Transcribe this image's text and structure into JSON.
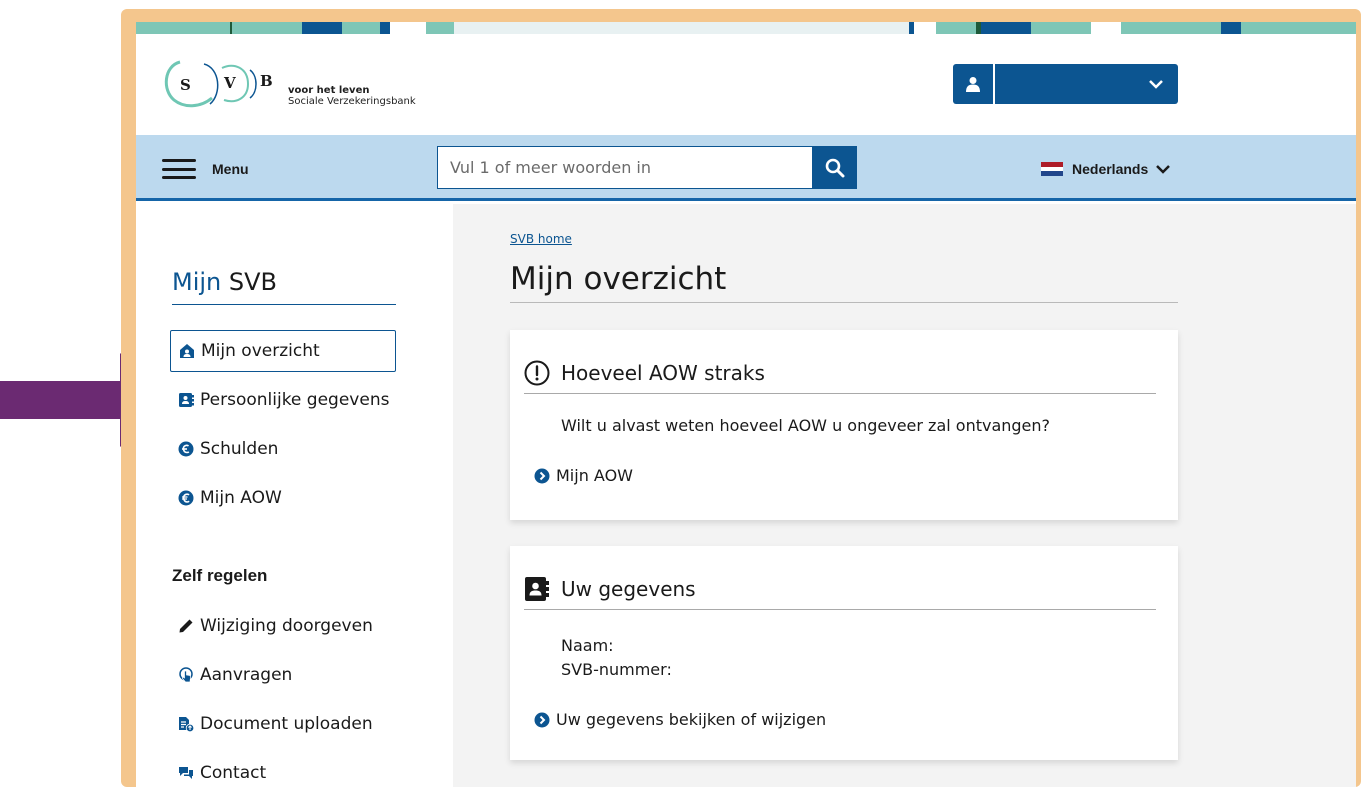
{
  "colors": {
    "frame": "#f4c68d",
    "primary": "#0c5591",
    "nav_bg": "#bcd9ee",
    "main_bg": "#f3f3f3",
    "arrow": "#6b2a72",
    "logo_swoosh": "#6fc7b4"
  },
  "logo": {
    "letters": [
      "S",
      "V",
      "B"
    ],
    "tagline": "voor het leven",
    "org_name": "Sociale Verzekeringsbank"
  },
  "account": {
    "icon": "user-icon",
    "chevron": "chevron-down-icon"
  },
  "nav": {
    "menu_label": "Menu",
    "search_placeholder": "Vul 1 of meer woorden in",
    "search_icon": "search-icon",
    "language": "Nederlands",
    "language_flag": "flag-nl-icon"
  },
  "sidebar": {
    "title_prefix": "Mijn",
    "title_suffix": "SVB",
    "items": [
      {
        "label": "Mijn overzicht",
        "icon": "home-icon",
        "active": true
      },
      {
        "label": "Persoonlijke gegevens",
        "icon": "address-book-icon"
      },
      {
        "label": "Schulden",
        "icon": "euro-minus-icon"
      },
      {
        "label": "Mijn AOW",
        "icon": "euro-icon"
      }
    ],
    "section_title": "Zelf regelen",
    "section_items": [
      {
        "label": "Wijziging doorgeven",
        "icon": "pencil-icon"
      },
      {
        "label": "Aanvragen",
        "icon": "hand-pointer-icon"
      },
      {
        "label": "Document uploaden",
        "icon": "file-upload-icon"
      },
      {
        "label": "Contact",
        "icon": "chat-icon"
      }
    ]
  },
  "main": {
    "breadcrumb": "SVB home",
    "title": "Mijn overzicht",
    "cards": [
      {
        "title": "Hoeveel AOW straks",
        "icon": "exclamation-circle-icon",
        "text": "Wilt u alvast weten hoeveel AOW u ongeveer zal ontvangen?",
        "link": "Mijn AOW"
      },
      {
        "title": "Uw gegevens",
        "icon": "address-book-icon",
        "line1": "Naam:",
        "line2": "SVB-nummer:",
        "link": "Uw gegevens bekijken of wijzigen"
      }
    ]
  }
}
